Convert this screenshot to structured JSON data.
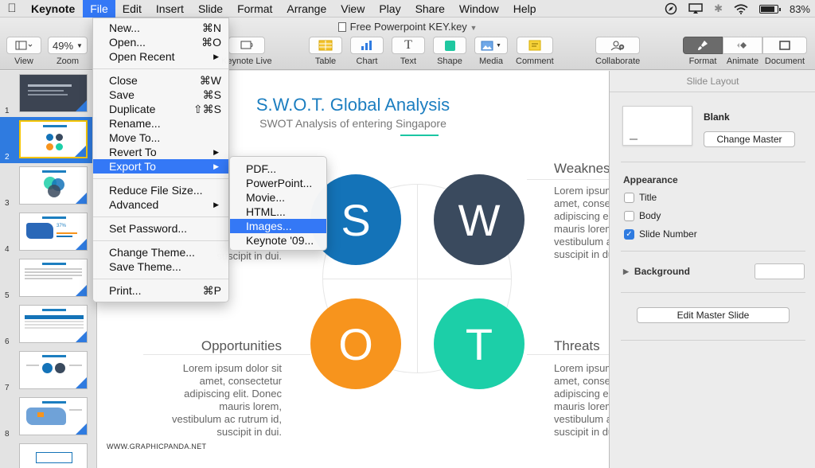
{
  "menubar": {
    "app": "Keynote",
    "items": [
      "File",
      "Edit",
      "Insert",
      "Slide",
      "Format",
      "Arrange",
      "View",
      "Play",
      "Share",
      "Window",
      "Help"
    ],
    "battery": "83%"
  },
  "window": {
    "title": "Free Powerpoint KEY.key"
  },
  "toolbar": {
    "view_label": "View",
    "zoom_value": "49%",
    "zoom_label": "Zoom",
    "keynote_live_label": "Keynote Live",
    "table_label": "Table",
    "chart_label": "Chart",
    "text_label": "Text",
    "shape_label": "Shape",
    "media_label": "Media",
    "comment_label": "Comment",
    "collaborate_label": "Collaborate",
    "format_label": "Format",
    "animate_label": "Animate",
    "document_label": "Document"
  },
  "file_menu": {
    "items": [
      {
        "label": "New...",
        "shortcut": "⌘N"
      },
      {
        "label": "Open...",
        "shortcut": "⌘O"
      },
      {
        "label": "Open Recent",
        "submenu": true
      },
      {
        "label": "Close",
        "shortcut": "⌘W"
      },
      {
        "label": "Save",
        "shortcut": "⌘S"
      },
      {
        "label": "Duplicate",
        "shortcut": "⇧⌘S"
      },
      {
        "label": "Rename..."
      },
      {
        "label": "Move To..."
      },
      {
        "label": "Revert To",
        "submenu": true
      },
      {
        "label": "Export To",
        "submenu": true
      },
      {
        "label": "Reduce File Size..."
      },
      {
        "label": "Advanced",
        "submenu": true
      },
      {
        "label": "Set Password..."
      },
      {
        "label": "Change Theme..."
      },
      {
        "label": "Save Theme..."
      },
      {
        "label": "Print...",
        "shortcut": "⌘P"
      }
    ]
  },
  "export_submenu": {
    "items": [
      "PDF...",
      "PowerPoint...",
      "Movie...",
      "HTML...",
      "Images...",
      "Keynote '09..."
    ]
  },
  "navigator": {
    "slide_numbers": [
      "1",
      "2",
      "3",
      "4",
      "5",
      "6",
      "7",
      "8"
    ],
    "thumb_texts": {
      "t4_percent": "37%"
    }
  },
  "slide": {
    "title": "S.W.O.T. Global Analysis",
    "subtitle": "SWOT Analysis of entering Singapore",
    "letters": {
      "s": "S",
      "w": "W",
      "o": "O",
      "t": "T"
    },
    "colors": {
      "s": "#1473b8",
      "w": "#3a4a5e",
      "o": "#f7941d",
      "t": "#1ccfa8"
    },
    "weakness_heading": "Weakness",
    "weakness_lines": [
      "Lorem ipsum dolor sit",
      "amet, consectetur",
      "adipiscing elit. Donec",
      "mauris lorem,",
      "vestibulum ac rutrum id,",
      "suscipit in dui."
    ],
    "strengths_visible_line": "suscipit in dui.",
    "opportunities_heading": "Opportunities",
    "opportunities_lines": [
      "Lorem ipsum dolor sit",
      "amet, consectetur",
      "adipiscing elit. Donec",
      "mauris lorem,",
      "vestibulum ac rutrum id,",
      "suscipit in dui."
    ],
    "threats_heading": "Threats",
    "threats_lines": [
      "Lorem ipsum dolor sit",
      "amet, consectetur",
      "adipiscing elit. Donec",
      "mauris lorem,",
      "vestibulum ac rutrum id,",
      "suscipit in dui."
    ],
    "footer": "WWW.GRAPHICPANDA.NET"
  },
  "inspector": {
    "title": "Slide Layout",
    "master_name": "Blank",
    "change_master": "Change Master",
    "appearance": "Appearance",
    "checkbox_title": "Title",
    "checkbox_body": "Body",
    "checkbox_slide_number": "Slide Number",
    "background": "Background",
    "edit_master": "Edit Master Slide"
  }
}
